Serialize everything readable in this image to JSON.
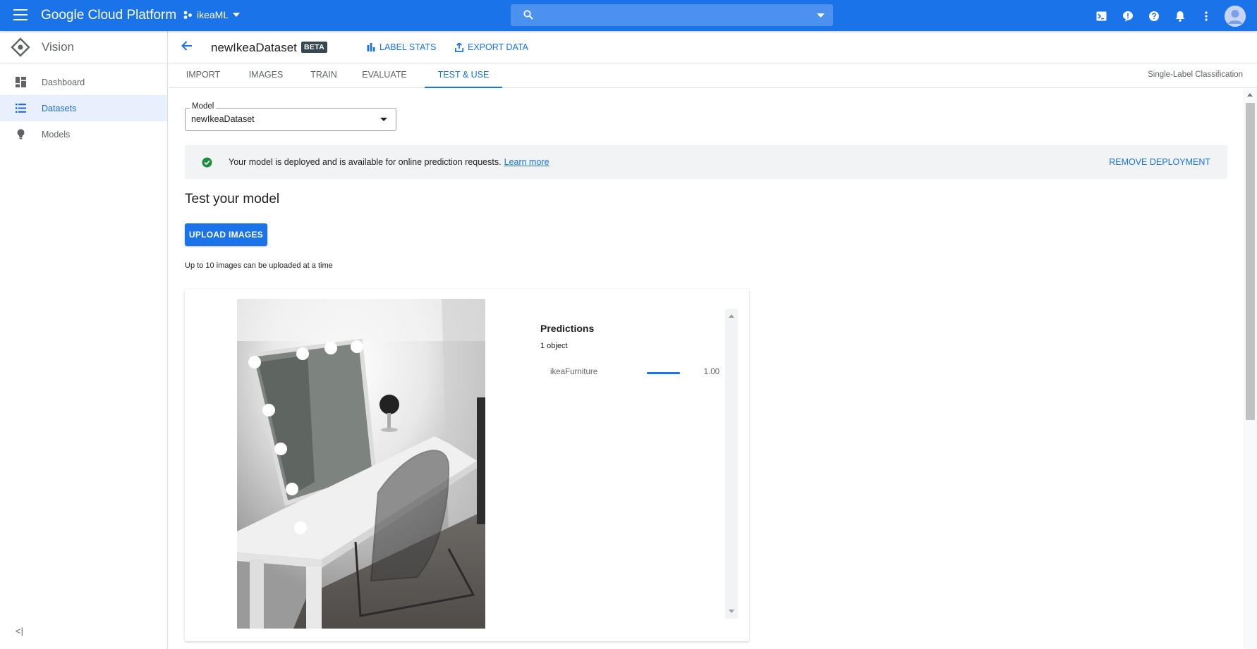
{
  "topbar": {
    "brand": "Google Cloud Platform",
    "project": "ikeaML",
    "search_placeholder": "",
    "icons": [
      "cloud-shell-icon",
      "feedback-icon",
      "help-icon",
      "notifications-icon",
      "more-vert-icon",
      "account-avatar"
    ]
  },
  "sidebar": {
    "product": "Vision",
    "items": [
      {
        "label": "Dashboard",
        "icon": "dashboard-icon",
        "active": false
      },
      {
        "label": "Datasets",
        "icon": "list-icon",
        "active": true
      },
      {
        "label": "Models",
        "icon": "lightbulb-icon",
        "active": false
      }
    ],
    "collapse_label": "<|"
  },
  "header": {
    "title": "newIkeaDataset",
    "badge": "BETA",
    "label_stats": "LABEL STATS",
    "export_data": "EXPORT DATA"
  },
  "tabs": {
    "items": [
      "IMPORT",
      "IMAGES",
      "TRAIN",
      "EVALUATE",
      "TEST & USE"
    ],
    "active": "TEST & USE",
    "classification": "Single-Label Classification"
  },
  "model": {
    "label": "Model",
    "value": "newIkeaDataset"
  },
  "banner": {
    "message": "Your model is deployed and is available for online prediction requests.",
    "learn_more": "Learn more",
    "remove": "REMOVE DEPLOYMENT"
  },
  "test": {
    "title": "Test your model",
    "upload_label": "UPLOAD IMAGES",
    "hint": "Up to 10 images can be uploaded at a time"
  },
  "predictions": {
    "title": "Predictions",
    "count": "1 object",
    "rows": [
      {
        "label": "ikeaFurniture",
        "score_text": "1.00",
        "score": 1.0
      }
    ]
  },
  "colors": {
    "brand_blue": "#1a73e8",
    "success_green": "#1e8e3e"
  }
}
